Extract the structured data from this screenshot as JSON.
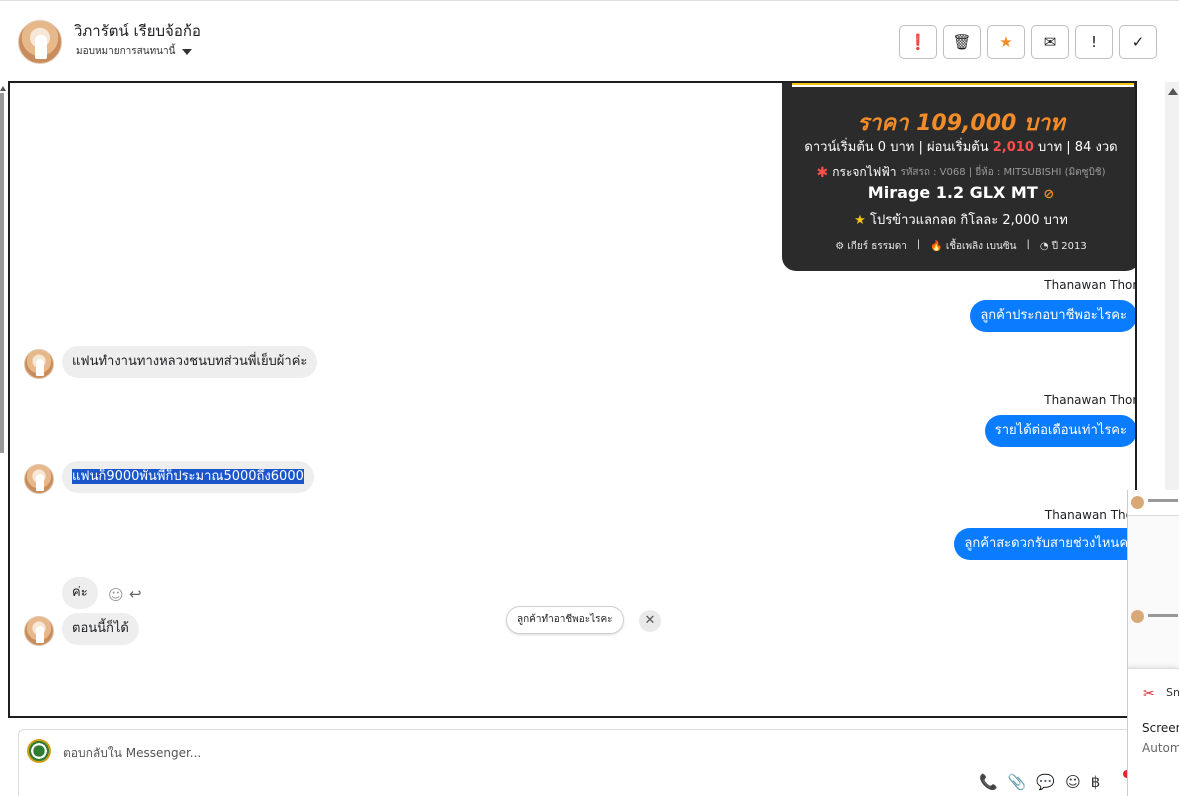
{
  "header": {
    "contact_name": "วิภารัตน์ เรียบจ้อก้อ",
    "assign_label": "มอบหมายการสนทนานี้",
    "toolbar": [
      {
        "name": "spam-button",
        "glyph": "❗"
      },
      {
        "name": "delete-button",
        "glyph": "🗑"
      },
      {
        "name": "star-button",
        "glyph": "★"
      },
      {
        "name": "mark-unread-button",
        "glyph": "✉"
      },
      {
        "name": "important-button",
        "glyph": "!"
      },
      {
        "name": "done-button",
        "glyph": "✓"
      }
    ]
  },
  "card": {
    "price": "ราคา 109,000 บาท",
    "down_prefix": "ดาวน์เริ่มต้น 0 บาท | ผ่อนเริ่มต้น",
    "down_amount": "2,010",
    "down_suffix": "บาท | 84 งวด",
    "feature": "กระจกไฟฟ้า",
    "meta": "รหัสรถ : V068 | ยี่ห้อ : MITSUBISHI (มิตซูบิชิ)",
    "model": "Mirage 1.2 GLX MT",
    "promo": "โปรข้าวแลกลด กิโลละ 2,000 บาท",
    "specs": [
      "⚙ เกียร์ ธรรมดา",
      "|",
      "🔥 เชื้อเพลิง เบนซิน",
      "|",
      "◔ ปี 2013"
    ]
  },
  "messages": {
    "sender_1": "Thanawan Thon",
    "out_1": "ลูกค้าประกอบาชีพอะไรคะ",
    "in_1": "แฟนทำงานทางหลวงชนบทส่วนพี่เย็บผ้าค่ะ",
    "sender_2": "Thanawan Thon",
    "out_2": "รายได้ต่อเดือนเท่าไรคะ",
    "in_2": "แฟนก็9000พันพี่ก็ประมาณ5000ถึง6000",
    "sender_3": "Thanawan Tho",
    "out_3": "ลูกค้าสะดวกรับสายช่วงไหนคะ",
    "in_3": "ค่ะ",
    "in_4": "ตอนนี้ก็ได้"
  },
  "suggestion": {
    "text": "ลูกค้าทำอาชีพอะไรคะ",
    "close": "✕"
  },
  "composer": {
    "placeholder": "ตอบกลับใน Messenger...",
    "icons": [
      "📞",
      "📎",
      "💬",
      "☺",
      "฿"
    ]
  },
  "side_panel": {
    "snip_title": "Sn",
    "snip_line1": "Screer",
    "snip_line2": "Autom"
  },
  "colors": {
    "outgoing_bubble": "#0a7cff",
    "incoming_bubble": "#eeeeee",
    "price_orange": "#f28c28",
    "card_bg": "#2b2b2b"
  }
}
